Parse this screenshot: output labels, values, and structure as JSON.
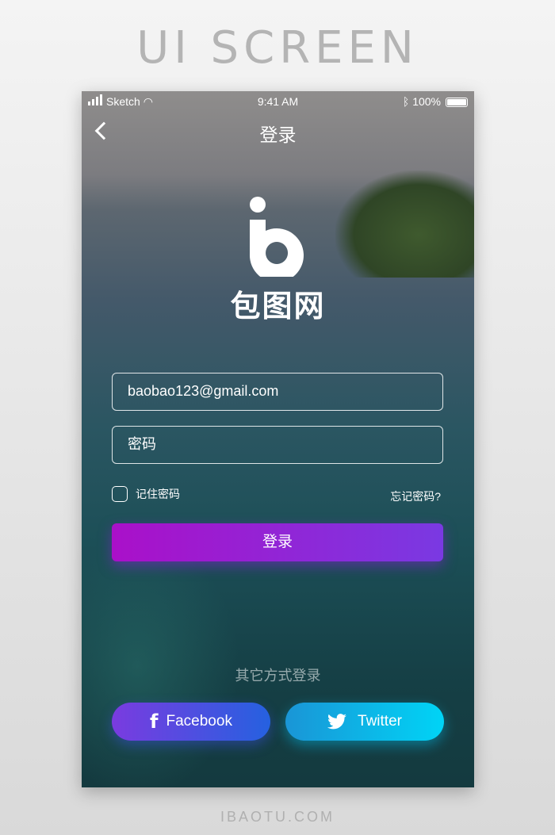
{
  "header": {
    "title": "UI SCREEN"
  },
  "footer": {
    "text": "IBAOTU.COM"
  },
  "status_bar": {
    "carrier": "Sketch",
    "time": "9:41 AM",
    "battery": "100%"
  },
  "nav": {
    "title": "登录"
  },
  "brand": {
    "name": "包图网"
  },
  "form": {
    "email_value": "baobao123@gmail.com",
    "password_placeholder": "密码",
    "remember_label": "记住密码",
    "remember_checked": false,
    "forgot_label": "忘记密码?",
    "login_label": "登录"
  },
  "social": {
    "heading": "其它方式登录",
    "facebook_label": "Facebook",
    "twitter_label": "Twitter"
  },
  "colors": {
    "login_start": "#aa10c9",
    "login_end": "#7a39e2",
    "facebook_start": "#7a3be0",
    "facebook_end": "#2561e0",
    "twitter_start": "#1a95d6",
    "twitter_end": "#00d4f6"
  }
}
